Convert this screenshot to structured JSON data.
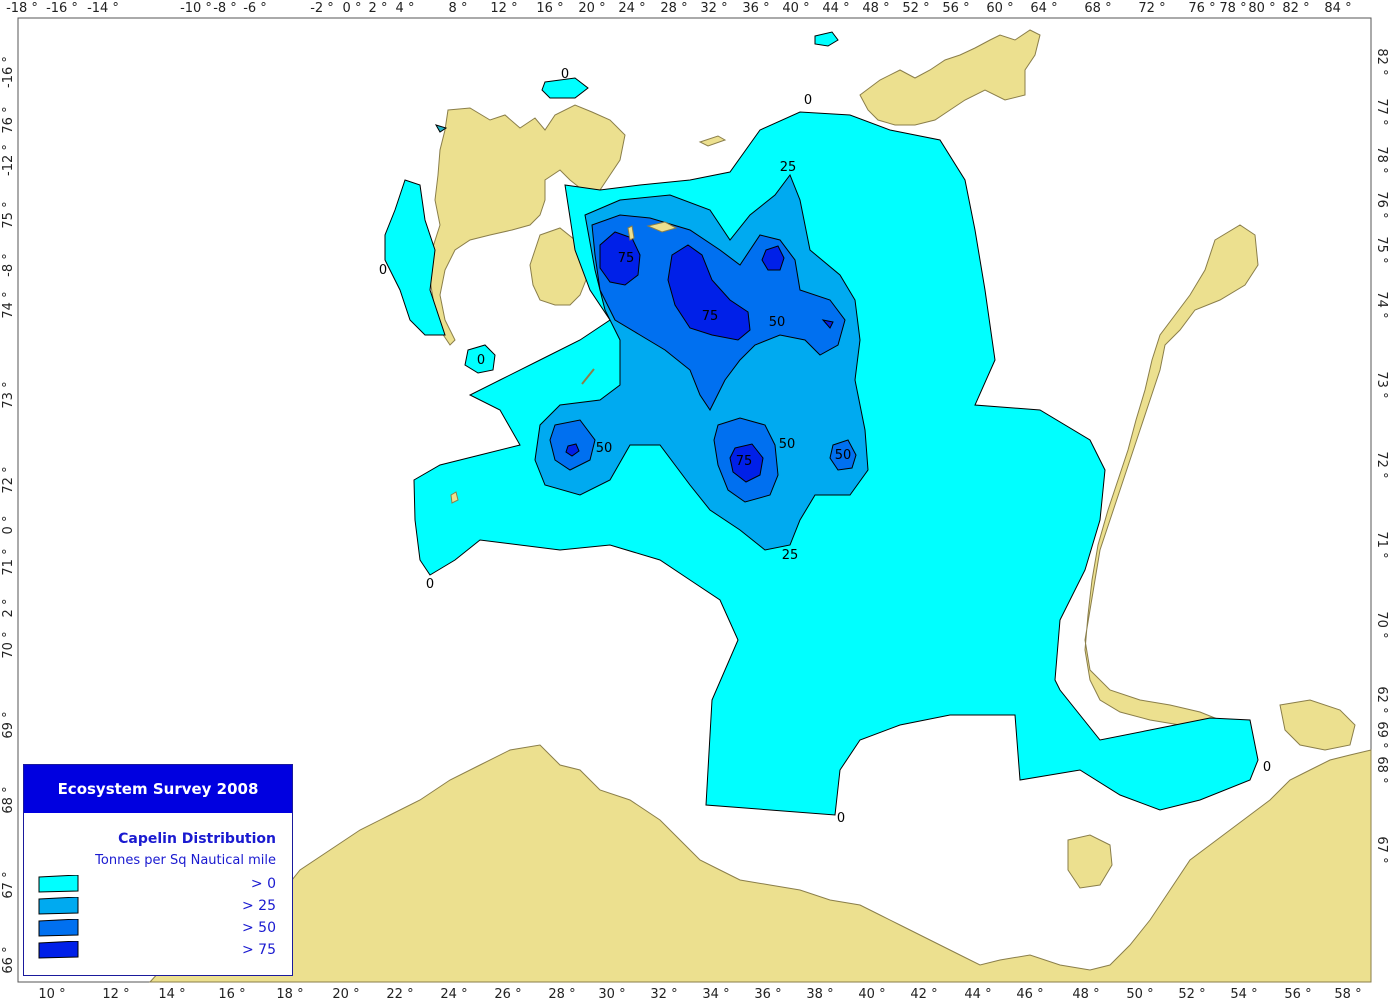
{
  "top_axis": [
    "-18 °",
    "-16 °",
    "-14 °",
    "-10 °",
    "-8 °",
    "-6 °",
    "-2 °",
    "0 °",
    "2 °",
    "4 °",
    "8 °",
    "12 °",
    "16 °",
    "20 °",
    "24 °",
    "28 °",
    "32 °",
    "36 °",
    "40 °",
    "44 °",
    "48 °",
    "52 °",
    "56 °",
    "60 °",
    "64 °",
    "68 °",
    "72 °",
    "76 °",
    "78 °",
    "80 °",
    "82 °",
    "84 °"
  ],
  "bottom_axis": [
    "10 °",
    "12 °",
    "14 °",
    "16 °",
    "18 °",
    "20 °",
    "22 °",
    "24 °",
    "26 °",
    "28 °",
    "30 °",
    "32 °",
    "34 °",
    "36 °",
    "38 °",
    "40 °",
    "42 °",
    "44 °",
    "46 °",
    "48 °",
    "50 °",
    "52 °",
    "54 °",
    "56 °",
    "58 °"
  ],
  "left_axis": [
    "-16 °",
    "76 °",
    "-12 °",
    "75 °",
    "-8 °",
    "74 °",
    "73 °",
    "72 °",
    "0 °",
    "71 °",
    "2 °",
    "70 °",
    "69 °",
    "68 °",
    "67 °",
    "66 °"
  ],
  "right_axis": [
    "82 °",
    "77 °",
    "78 °",
    "76 °",
    "75 °",
    "74 °",
    "73 °",
    "72 °",
    "71 °",
    "70 °",
    "62 °",
    "69 °",
    "68 °",
    "67 °"
  ],
  "contour_labels": [
    "0",
    "0",
    "0",
    "0",
    "0",
    "0",
    "0",
    "25",
    "25",
    "50",
    "50",
    "50",
    "50",
    "75",
    "75",
    "75"
  ],
  "legend": {
    "title": "Ecosystem Survey 2008",
    "subtitle": "Capelin Distribution",
    "units": "Tonnes per Sq Nautical mile",
    "items": [
      {
        "label": "> 0",
        "color": "#00ffff"
      },
      {
        "label": "> 25",
        "color": "#00aaf0"
      },
      {
        "label": "> 50",
        "color": "#0070f0"
      },
      {
        "label": "> 75",
        "color": "#0020e8"
      }
    ]
  }
}
